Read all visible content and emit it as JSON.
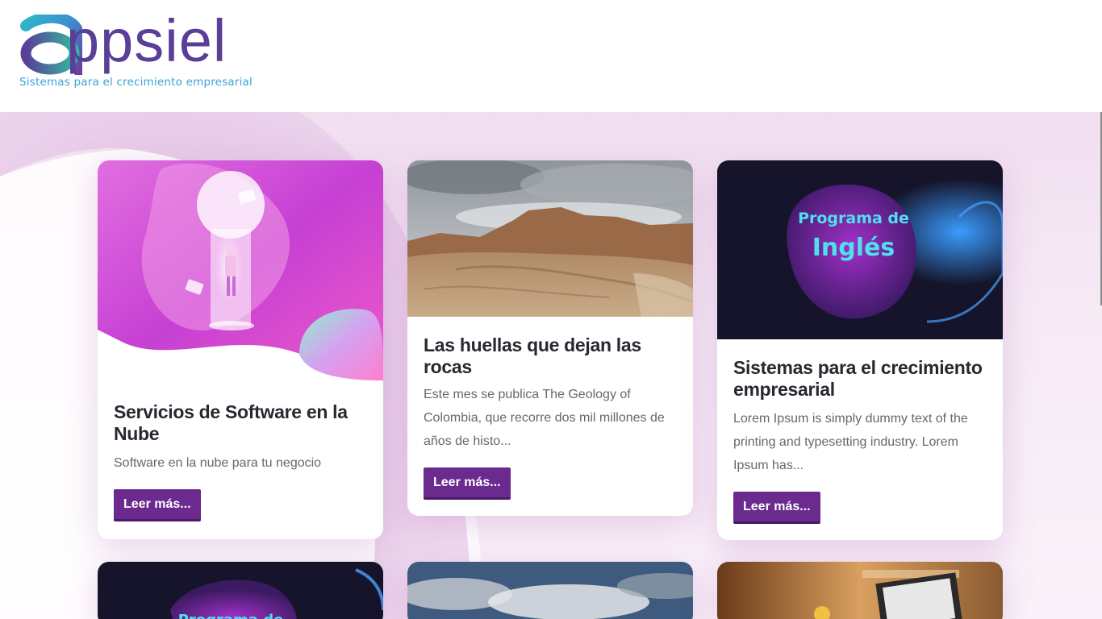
{
  "brand": {
    "name": "ppsiel",
    "tagline": "Sistemas para el crecimiento empresarial"
  },
  "cards": [
    {
      "title": "Servicios de Software en la Nube",
      "text": "Software en la nube para tu negocio",
      "button": "Leer más..."
    },
    {
      "title": "Las huellas que dejan las rocas",
      "text": "Este mes se publica The Geology of Colombia, que recorre dos mil millones de años de histo...",
      "button": "Leer más..."
    },
    {
      "title": "Sistemas para el crecimiento empresarial",
      "text": "Lorem Ipsum is simply dummy text of the printing and typesetting industry. Lorem Ipsum has...",
      "button": "Leer más...",
      "image_caption_line1": "Programa de",
      "image_caption_line2": "Inglés"
    }
  ],
  "second_row": {
    "card1_caption": "Programa de"
  },
  "colors": {
    "brand_purple": "#5a3e98",
    "tagline_blue": "#3aa3d6",
    "button_purple": "#6a2a8e"
  }
}
